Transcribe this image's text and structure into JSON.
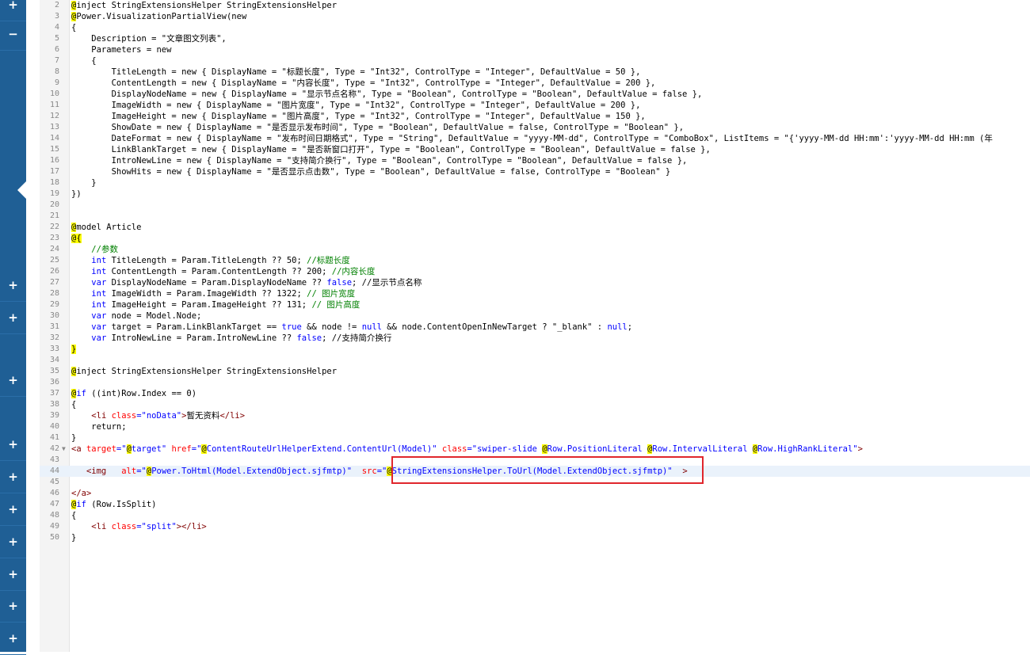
{
  "sidebar": {
    "top_buttons": [
      "+",
      "−"
    ],
    "buttons": [
      "+",
      "+",
      "+",
      "+",
      "+",
      "+",
      "+",
      "+",
      "+",
      "+"
    ]
  },
  "editor": {
    "active_line": 44,
    "lines": [
      {
        "n": "2",
        "s": [
          [
            "@",
            "at"
          ],
          [
            "inject StringExtensionsHelper StringExtensionsHelper",
            ""
          ]
        ]
      },
      {
        "n": "3",
        "s": [
          [
            "@",
            "at"
          ],
          [
            "Power.VisualizationPartialView(new",
            ""
          ]
        ]
      },
      {
        "n": "4",
        "s": [
          [
            "{",
            ""
          ]
        ]
      },
      {
        "n": "5",
        "s": [
          [
            "    Description = \"文章图文列表\",",
            ""
          ]
        ]
      },
      {
        "n": "6",
        "s": [
          [
            "    Parameters = new",
            ""
          ]
        ]
      },
      {
        "n": "7",
        "s": [
          [
            "    {",
            ""
          ]
        ]
      },
      {
        "n": "8",
        "s": [
          [
            "        TitleLength = new { DisplayName = \"标题长度\", Type = \"Int32\", ControlType = \"Integer\", DefaultValue = 50 },",
            ""
          ]
        ]
      },
      {
        "n": "9",
        "s": [
          [
            "        ContentLength = new { DisplayName = \"内容长度\", Type = \"Int32\", ControlType = \"Integer\", DefaultValue = 200 },",
            ""
          ]
        ]
      },
      {
        "n": "10",
        "s": [
          [
            "        DisplayNodeName = new { DisplayName = \"显示节点名称\", Type = \"Boolean\", ControlType = \"Boolean\", DefaultValue = false },",
            ""
          ]
        ]
      },
      {
        "n": "11",
        "s": [
          [
            "        ImageWidth = new { DisplayName = \"图片宽度\", Type = \"Int32\", ControlType = \"Integer\", DefaultValue = 200 },",
            ""
          ]
        ]
      },
      {
        "n": "12",
        "s": [
          [
            "        ImageHeight = new { DisplayName = \"图片高度\", Type = \"Int32\", ControlType = \"Integer\", DefaultValue = 150 },",
            ""
          ]
        ]
      },
      {
        "n": "13",
        "s": [
          [
            "        ShowDate = new { DisplayName = \"是否显示发布时间\", Type = \"Boolean\", DefaultValue = false, ControlType = \"Boolean\" },",
            ""
          ]
        ]
      },
      {
        "n": "14",
        "s": [
          [
            "        DateFormat = new { DisplayName = \"发布时间日期格式\", Type = \"String\", DefaultValue = \"yyyy-MM-dd\", ControlType = \"ComboBox\", ListItems = \"{'yyyy-MM-dd HH:mm':'yyyy-MM-dd HH:mm (年",
            ""
          ]
        ]
      },
      {
        "n": "15",
        "s": [
          [
            "        LinkBlankTarget = new { DisplayName = \"是否新窗口打开\", Type = \"Boolean\", ControlType = \"Boolean\", DefaultValue = false },",
            ""
          ]
        ]
      },
      {
        "n": "16",
        "s": [
          [
            "        IntroNewLine = new { DisplayName = \"支持简介换行\", Type = \"Boolean\", ControlType = \"Boolean\", DefaultValue = false },",
            ""
          ]
        ]
      },
      {
        "n": "17",
        "s": [
          [
            "        ShowHits = new { DisplayName = \"是否显示点击数\", Type = \"Boolean\", DefaultValue = false, ControlType = \"Boolean\" }",
            ""
          ]
        ]
      },
      {
        "n": "18",
        "s": [
          [
            "    }",
            ""
          ]
        ]
      },
      {
        "n": "19",
        "s": [
          [
            "})",
            ""
          ]
        ]
      },
      {
        "n": "20",
        "s": []
      },
      {
        "n": "21",
        "s": []
      },
      {
        "n": "22",
        "s": [
          [
            "@",
            "at"
          ],
          [
            "model Article",
            ""
          ]
        ]
      },
      {
        "n": "23",
        "s": [
          [
            "@",
            "at"
          ],
          [
            "{",
            "at"
          ]
        ]
      },
      {
        "n": "24",
        "s": [
          [
            "    ",
            ""
          ],
          [
            "//参数",
            "cm"
          ]
        ]
      },
      {
        "n": "25",
        "s": [
          [
            "    ",
            ""
          ],
          [
            "int",
            "kw"
          ],
          [
            " TitleLength = Param.TitleLength ?? 50; ",
            ""
          ],
          [
            "//标题长度",
            "cm"
          ]
        ]
      },
      {
        "n": "26",
        "s": [
          [
            "    ",
            ""
          ],
          [
            "int",
            "kw"
          ],
          [
            " ContentLength = Param.ContentLength ?? 200; ",
            ""
          ],
          [
            "//内容长度",
            "cm"
          ]
        ]
      },
      {
        "n": "27",
        "s": [
          [
            "    ",
            ""
          ],
          [
            "var",
            "kw"
          ],
          [
            " DisplayNodeName = Param.DisplayNodeName ?? ",
            ""
          ],
          [
            "false",
            "kw"
          ],
          [
            "; //显示节点名称",
            ""
          ]
        ]
      },
      {
        "n": "28",
        "s": [
          [
            "    ",
            ""
          ],
          [
            "int",
            "kw"
          ],
          [
            " ImageWidth = Param.ImageWidth ?? 1322; ",
            ""
          ],
          [
            "// 图片宽度",
            "cm"
          ]
        ]
      },
      {
        "n": "29",
        "s": [
          [
            "    ",
            ""
          ],
          [
            "int",
            "kw"
          ],
          [
            " ImageHeight = Param.ImageHeight ?? 131; ",
            ""
          ],
          [
            "// 图片高度",
            "cm"
          ]
        ]
      },
      {
        "n": "30",
        "s": [
          [
            "    ",
            ""
          ],
          [
            "var",
            "kw"
          ],
          [
            " node = Model.Node;",
            ""
          ]
        ]
      },
      {
        "n": "31",
        "s": [
          [
            "    ",
            ""
          ],
          [
            "var",
            "kw"
          ],
          [
            " target = Param.LinkBlankTarget == ",
            ""
          ],
          [
            "true",
            "kw"
          ],
          [
            " && node != ",
            ""
          ],
          [
            "null",
            "kw"
          ],
          [
            " && node.ContentOpenInNewTarget ? \"_blank\" : ",
            ""
          ],
          [
            "null",
            "kw"
          ],
          [
            ";",
            ""
          ]
        ]
      },
      {
        "n": "32",
        "s": [
          [
            "    ",
            ""
          ],
          [
            "var",
            "kw"
          ],
          [
            " IntroNewLine = Param.IntroNewLine ?? ",
            ""
          ],
          [
            "false",
            "kw"
          ],
          [
            "; //支持简介换行",
            ""
          ]
        ]
      },
      {
        "n": "33",
        "s": [
          [
            "}",
            "at"
          ]
        ]
      },
      {
        "n": "34",
        "s": []
      },
      {
        "n": "35",
        "s": [
          [
            "@",
            "at"
          ],
          [
            "inject StringExtensionsHelper StringExtensionsHelper",
            ""
          ]
        ]
      },
      {
        "n": "36",
        "s": []
      },
      {
        "n": "37",
        "s": [
          [
            "@",
            "at"
          ],
          [
            "if",
            "kw"
          ],
          [
            " ((int)Row.Index == 0)",
            ""
          ]
        ]
      },
      {
        "n": "38",
        "s": [
          [
            "{",
            ""
          ]
        ]
      },
      {
        "n": "39",
        "s": [
          [
            "    ",
            ""
          ],
          [
            "<li ",
            "tag"
          ],
          [
            "class",
            "attr"
          ],
          [
            "=\"noData\"",
            "str"
          ],
          [
            ">",
            "tag"
          ],
          [
            "暂无资料",
            ""
          ],
          [
            "</li>",
            "tag"
          ]
        ]
      },
      {
        "n": "40",
        "s": [
          [
            "    return;",
            ""
          ]
        ]
      },
      {
        "n": "41",
        "s": [
          [
            "}",
            ""
          ]
        ]
      },
      {
        "n": "42",
        "s": [
          [
            "<a ",
            "tag"
          ],
          [
            "target",
            "attr"
          ],
          [
            "=\"",
            "str"
          ],
          [
            "@",
            "at"
          ],
          [
            "target\" ",
            "str"
          ],
          [
            "href",
            "attr"
          ],
          [
            "=\"",
            "str"
          ],
          [
            "@",
            "at"
          ],
          [
            "ContentRouteUrlHelperExtend.ContentUrl(Model)\" ",
            "str"
          ],
          [
            "class",
            "attr"
          ],
          [
            "=\"swiper-slide ",
            "str"
          ],
          [
            "@",
            "at"
          ],
          [
            "Row.PositionLiteral ",
            "str"
          ],
          [
            "@",
            "at"
          ],
          [
            "Row.IntervalLiteral ",
            "str"
          ],
          [
            "@",
            "at"
          ],
          [
            "Row.HighRankLiteral\"",
            "str"
          ],
          [
            ">",
            "tag"
          ]
        ]
      },
      {
        "n": "43",
        "s": []
      },
      {
        "n": "44",
        "s": [
          [
            "   ",
            ""
          ],
          [
            "<img",
            "tag"
          ],
          [
            "   ",
            ""
          ],
          [
            "alt",
            "attr"
          ],
          [
            "=\"",
            "str"
          ],
          [
            "@",
            "at"
          ],
          [
            "Power.ToHtml(Model.ExtendObject.sjfmtp)\"",
            "str"
          ],
          [
            "  ",
            ""
          ],
          [
            "src",
            "attr"
          ],
          [
            "=\"",
            "str"
          ],
          [
            "@",
            "at"
          ],
          [
            "StringExtensionsHelper.ToUrl(Model.ExtendObject.sjfmtp)\"",
            "str"
          ],
          [
            "  ",
            ""
          ],
          [
            ">",
            "tag"
          ]
        ]
      },
      {
        "n": "45",
        "s": []
      },
      {
        "n": "46",
        "s": [
          [
            "</a>",
            "tag"
          ]
        ]
      },
      {
        "n": "47",
        "s": [
          [
            "@",
            "at"
          ],
          [
            "if",
            "kw"
          ],
          [
            " (Row.IsSplit)",
            ""
          ]
        ]
      },
      {
        "n": "48",
        "s": [
          [
            "{",
            ""
          ]
        ]
      },
      {
        "n": "49",
        "s": [
          [
            "    ",
            ""
          ],
          [
            "<li ",
            "tag"
          ],
          [
            "class",
            "attr"
          ],
          [
            "=\"split\"",
            "str"
          ],
          [
            "></li>",
            "tag"
          ]
        ]
      },
      {
        "n": "50",
        "s": [
          [
            "}",
            ""
          ]
        ]
      }
    ]
  }
}
